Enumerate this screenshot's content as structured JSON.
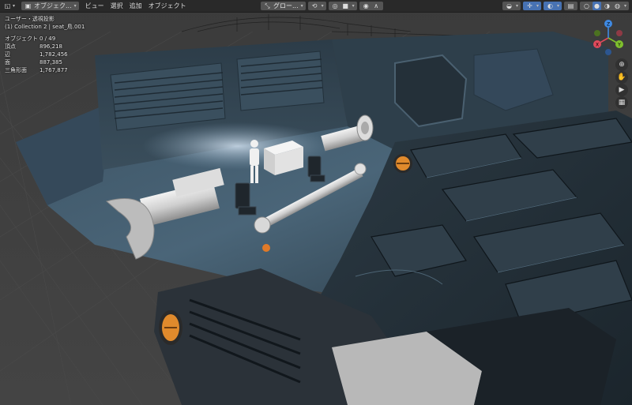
{
  "header": {
    "editor_type_icon": "3d-viewport-icon",
    "mode_label": "オブジェク...",
    "menus": [
      "ビュー",
      "選択",
      "追加",
      "オブジェクト"
    ],
    "orientation_label": "グロー...",
    "right_icons": [
      "visibility-icon",
      "gizmo-icon",
      "overlay-icon",
      "xray-icon",
      "shading-wire-icon",
      "shading-solid-icon",
      "shading-material-icon",
      "shading-rendered-icon"
    ]
  },
  "viewport": {
    "view_name": "ユーザー・透視投影",
    "collection_info": "(1) Collection 2 | seat_鳥.001",
    "stats": [
      {
        "label": "オブジェクト",
        "value": "0 / 49"
      },
      {
        "label": "頂点",
        "value": "896,218"
      },
      {
        "label": "辺",
        "value": "1,782,456"
      },
      {
        "label": "面",
        "value": "887,385"
      },
      {
        "label": "三角形面",
        "value": "1,767,877"
      }
    ]
  },
  "gizmo": {
    "x_label": "X",
    "y_label": "Y",
    "z_label": "Z"
  },
  "colors": {
    "accent": "#4772b3",
    "axis_x": "#e04a5c",
    "axis_y": "#7fbf2d",
    "axis_z": "#3f8ae3",
    "hull": "#3b4f5e"
  }
}
